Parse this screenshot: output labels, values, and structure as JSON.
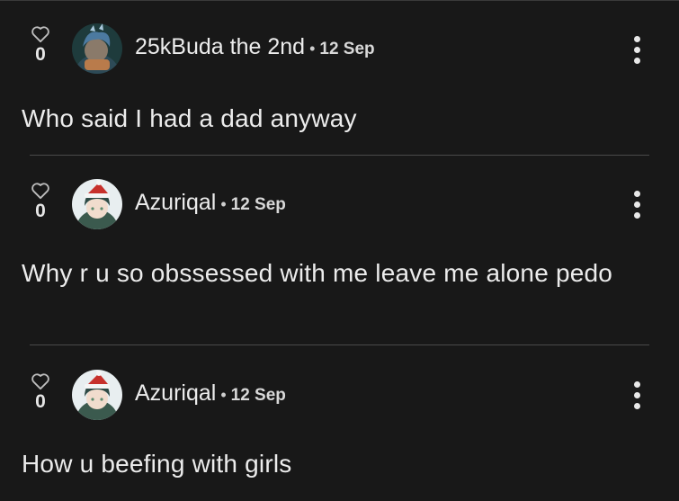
{
  "comments": [
    {
      "likes": "0",
      "username": "25kBuda the 2nd",
      "date": "12 Sep",
      "text": "Who said I had a dad anyway"
    },
    {
      "likes": "0",
      "username": "Azuriqal",
      "date": "12 Sep",
      "text": "Why r u so obssessed with me leave me alone pedo"
    },
    {
      "likes": "0",
      "username": "Azuriqal",
      "date": "12 Sep",
      "text": "How u beefing with girls"
    }
  ],
  "separator": "•",
  "icons": {
    "like": "heart-outline-icon",
    "menu": "more-vertical-icon"
  },
  "colors": {
    "background": "#181818",
    "text": "#ebebeb",
    "divider": "#4a4a4a"
  }
}
